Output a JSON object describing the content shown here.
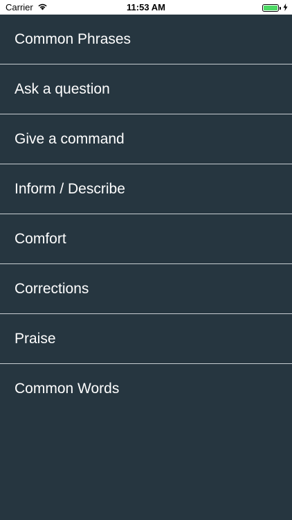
{
  "status_bar": {
    "carrier": "Carrier",
    "time": "11:53 AM",
    "wifi_icon": "wifi-icon",
    "battery_icon": "battery-icon",
    "charging_icon": "charging-bolt-icon",
    "battery_level": 1.0,
    "battery_color": "#4cd964"
  },
  "menu": {
    "items": [
      {
        "label": "Common Phrases"
      },
      {
        "label": "Ask a question"
      },
      {
        "label": "Give a command"
      },
      {
        "label": "Inform / Describe"
      },
      {
        "label": "Comfort"
      },
      {
        "label": "Corrections"
      },
      {
        "label": "Praise"
      },
      {
        "label": "Common Words"
      }
    ]
  },
  "colors": {
    "background": "#263640",
    "separator": "#c8ced2",
    "text": "#ffffff"
  }
}
